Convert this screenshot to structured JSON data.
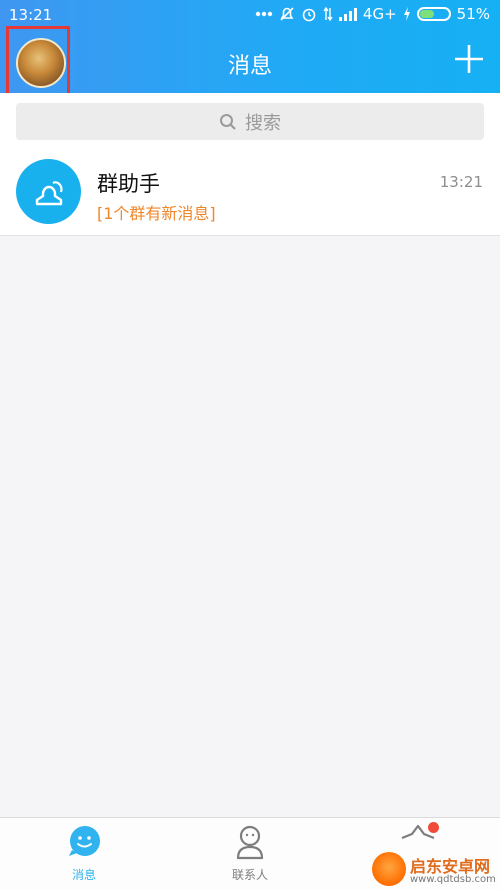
{
  "status_bar": {
    "time": "13:21",
    "network": "4G+",
    "battery": "51%",
    "battery_level": 0.51
  },
  "header": {
    "title": "消息"
  },
  "search": {
    "placeholder": "搜索"
  },
  "messages": [
    {
      "title": "群助手",
      "subtitle": "[1个群有新消息]",
      "time": "13:21"
    }
  ],
  "bottom_nav": {
    "items": [
      {
        "label": "消息",
        "active": true
      },
      {
        "label": "联系人",
        "active": false
      }
    ]
  },
  "watermark": {
    "text": "启东安卓网",
    "url": "www.qdtdsb.com"
  },
  "colors": {
    "accent": "#1eaaf1",
    "highlight": "#f0862a",
    "alert": "#e53935"
  }
}
